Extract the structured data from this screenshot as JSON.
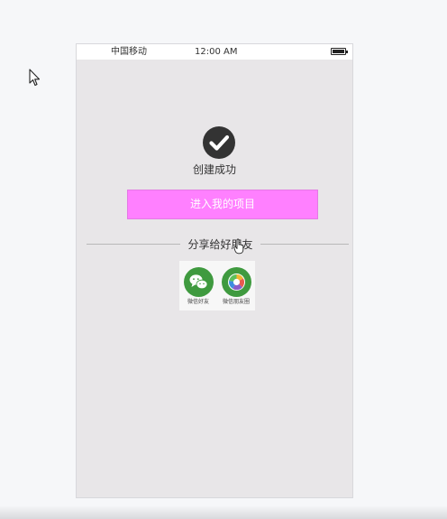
{
  "status_bar": {
    "carrier": "中国移动",
    "time": "12:00 AM",
    "battery_icon": "battery-full-icon"
  },
  "success": {
    "icon": "check-circle-icon",
    "message": "创建成功"
  },
  "primary_action": {
    "label": "进入我的项目"
  },
  "share": {
    "title": "分享给好朋友",
    "options": [
      {
        "label": "微信好友",
        "icon": "wechat-icon",
        "color": "#3f9a3f"
      },
      {
        "label": "微信朋友圈",
        "icon": "moments-icon",
        "color": "#3f9a3f"
      }
    ]
  },
  "colors": {
    "button_bg": "#ff80ff",
    "screen_bg": "#e8e6e8",
    "check_icon_bg": "#333333"
  }
}
